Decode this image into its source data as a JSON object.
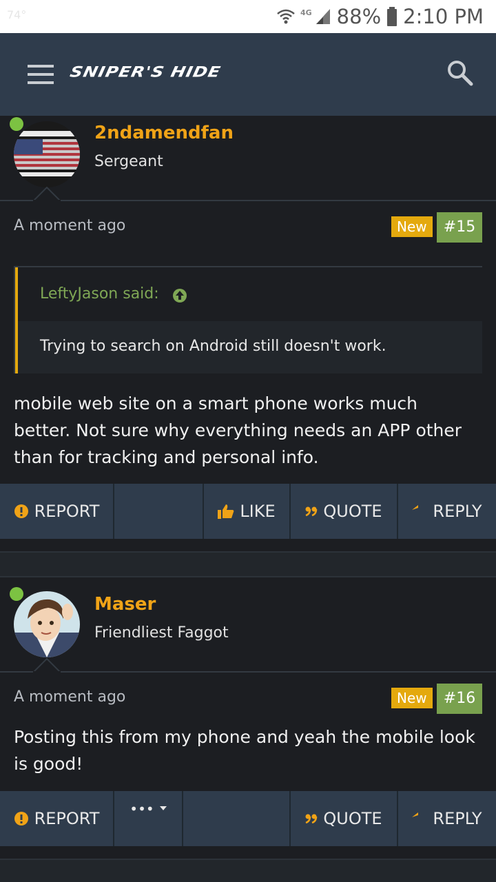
{
  "status_bar": {
    "temperature": "74°",
    "network": "4G",
    "battery": "88%",
    "time": "2:10 PM"
  },
  "header": {
    "logo": "SNIPER'S HIDE"
  },
  "posts": [
    {
      "username": "2ndamendfan",
      "user_title": "Sergeant",
      "time": "A moment ago",
      "badge_new": "New",
      "post_number": "#15",
      "quote": {
        "author": "LeftyJason said:",
        "text": "Trying to search on Android still doesn't work."
      },
      "body_lines": [
        "mobile web site on a smart phone works much",
        "better. Not sure why everything needs an APP other",
        "than for tracking and personal info."
      ],
      "actions": {
        "report": "REPORT",
        "like": "LIKE",
        "quote": "QUOTE",
        "reply": "REPLY"
      }
    },
    {
      "username": "Maser",
      "user_title": "Friendliest Faggot",
      "time": "A moment ago",
      "badge_new": "New",
      "post_number": "#16",
      "body_lines": [
        "Posting this from my phone and yeah the mobile look",
        "is good!"
      ],
      "actions": {
        "report": "REPORT",
        "more": "•••",
        "quote": "QUOTE",
        "reply": "REPLY"
      }
    }
  ],
  "colors": {
    "accent_orange": "#f0a317",
    "online_green": "#7cc242",
    "post_num_green": "#79a14e",
    "header_bg": "#2f3c4c"
  }
}
